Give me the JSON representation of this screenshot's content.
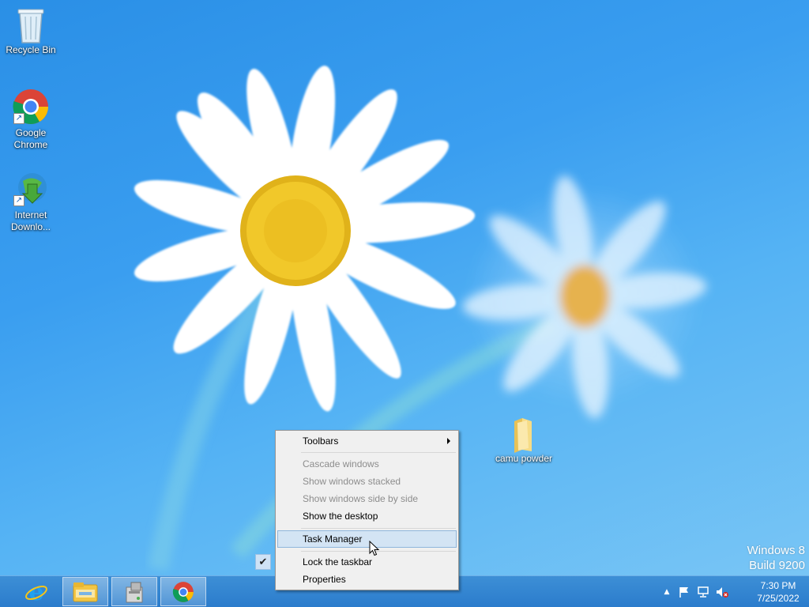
{
  "desktop": {
    "icons": [
      {
        "label": "Recycle Bin",
        "icon": "recycle-bin-icon"
      },
      {
        "label": "Google Chrome",
        "icon": "chrome-icon"
      },
      {
        "label": "Internet Downlo...",
        "icon": "internet-download-manager-icon"
      },
      {
        "label": "camu powder",
        "icon": "folder-icon"
      }
    ],
    "watermark": {
      "line1": "Windows 8",
      "line2": "Build 9200"
    }
  },
  "context_menu": {
    "items": [
      {
        "label": "Toolbars",
        "enabled": true,
        "submenu": true
      },
      {
        "label": "Cascade windows",
        "enabled": false
      },
      {
        "label": "Show windows stacked",
        "enabled": false
      },
      {
        "label": "Show windows side by side",
        "enabled": false
      },
      {
        "label": "Show the desktop",
        "enabled": true
      },
      {
        "label": "Task Manager",
        "enabled": true,
        "highlighted": true
      },
      {
        "label": "Lock the taskbar",
        "enabled": true,
        "checked": true
      },
      {
        "label": "Properties",
        "enabled": true
      }
    ]
  },
  "taskbar": {
    "buttons": [
      {
        "icon": "internet-explorer-icon"
      },
      {
        "icon": "file-explorer-icon"
      },
      {
        "icon": "setup-installer-icon"
      },
      {
        "icon": "chrome-icon"
      }
    ],
    "tray_icons": [
      "show-hidden-icons-icon",
      "action-center-flag-icon",
      "network-icon",
      "volume-muted-icon"
    ],
    "clock": {
      "time": "7:30 PM",
      "date": "7/25/2022"
    }
  },
  "colors": {
    "taskbar": "#2b7ccc",
    "menu_background": "#f0f0f0",
    "menu_highlight": "#d3e4f4"
  }
}
